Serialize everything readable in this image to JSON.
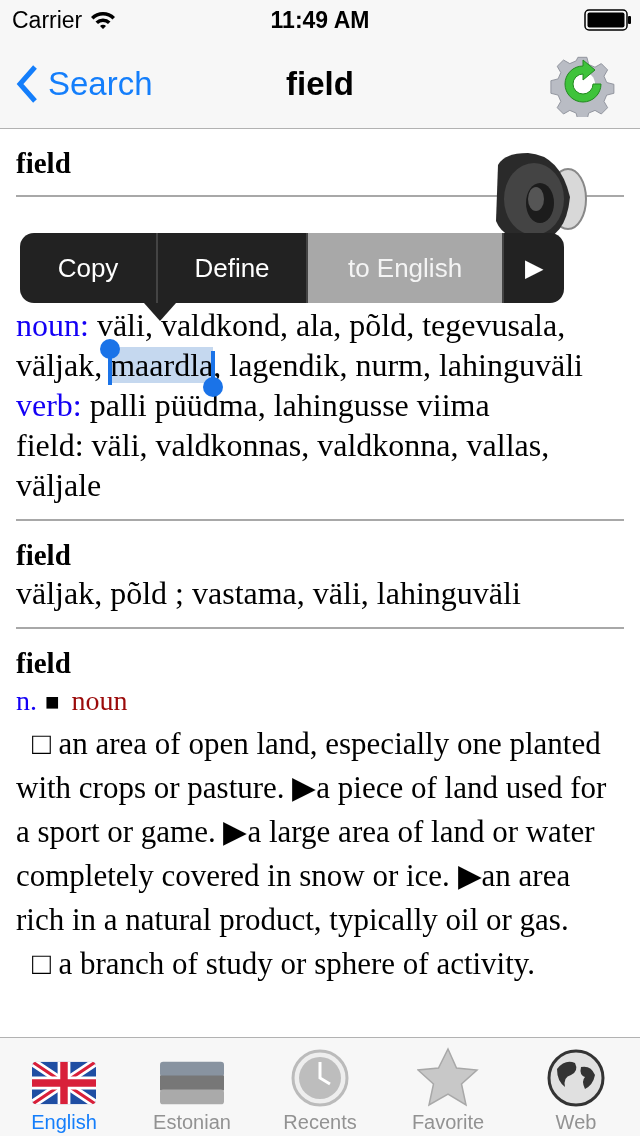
{
  "status_bar": {
    "carrier": "Carrier",
    "time": "11:49 AM"
  },
  "nav": {
    "back": "Search",
    "title": "field"
  },
  "entries": [
    {
      "headword": "field"
    },
    {
      "lines": [
        {
          "label": "noun:",
          "parts": [
            {
              "text": "väli, valdkond, ala, põld, tegevusala, väljak, ",
              "selected": false
            },
            {
              "text": "maardla",
              "selected": true
            },
            {
              "text": ", lagendik, nurm, lahinguväli",
              "selected": false
            }
          ]
        },
        {
          "label": "verb:",
          "parts": [
            {
              "text": "palli püüdma, lahingusse viima",
              "selected": false
            }
          ]
        },
        {
          "parts": [
            {
              "text": "field: väli, valdkonnas, valdkonna, vallas, väljale",
              "selected": false
            }
          ]
        }
      ]
    },
    {
      "headword": "field",
      "lines": [
        {
          "parts": [
            {
              "text": "väljak, põld ; vastama, väli, lahinguväli",
              "selected": false
            }
          ]
        }
      ]
    },
    {
      "headword": "field",
      "pos": {
        "abbr": "n.",
        "mark": "■",
        "name": "noun"
      },
      "senses": [
        "□ an area of open land, especially one planted with crops or pasture. ▶a piece of land used for a sport or game. ▶a large area of land or water completely covered in snow or ice. ▶an area rich in a natural product, typically oil or gas.",
        "□ a branch of study or sphere of activity."
      ]
    }
  ],
  "edit_menu": {
    "items": [
      {
        "label": "Copy",
        "selected": false
      },
      {
        "label": "Define",
        "selected": false
      },
      {
        "label": "to English",
        "selected": true
      }
    ],
    "more": "▶"
  },
  "tabs": [
    {
      "label": "English",
      "selected": true
    },
    {
      "label": "Estonian",
      "selected": false
    },
    {
      "label": "Recents",
      "selected": false
    },
    {
      "label": "Favorite",
      "selected": false
    },
    {
      "label": "Web",
      "selected": false
    }
  ]
}
